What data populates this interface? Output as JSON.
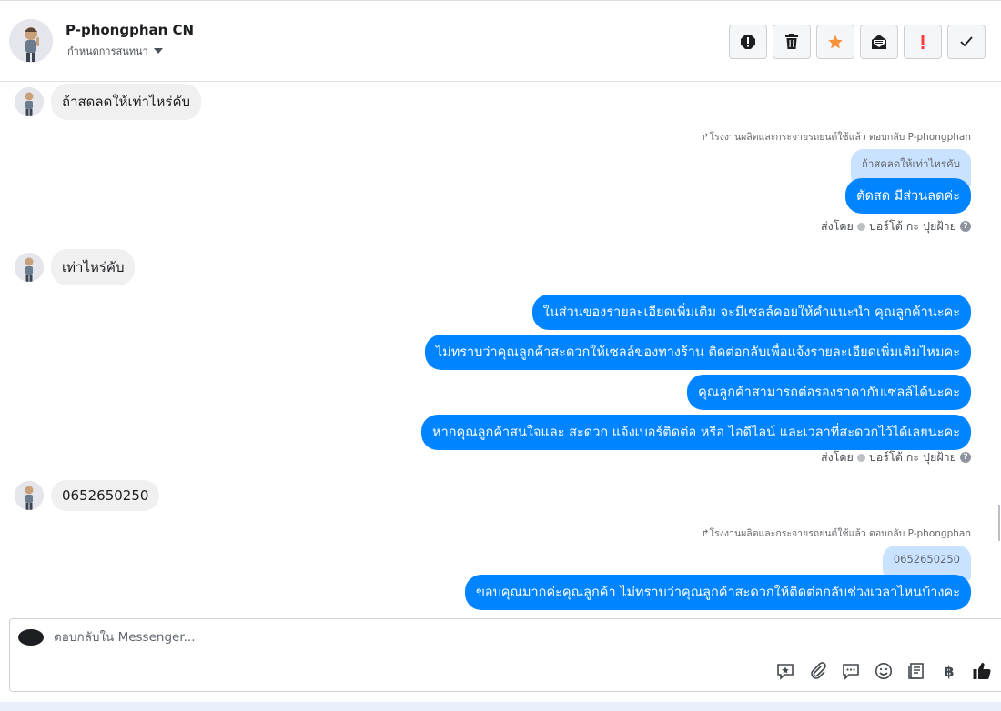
{
  "header": {
    "name": "P-phongphan CN",
    "sub_label": "กำหนดการสนทนา"
  },
  "messages": {
    "in_1": "ถ้าสดลดให้เท่าไหร่คับ",
    "reply_note_1": "โรงงานผลิตและกระจายรถยนต์ใช้แล้ว ตอบกลับ P-phongphan",
    "quoted_1": "ถ้าสดลดให้เท่าไหร่คับ",
    "out_1": "ตัดสด มีส่วนลดค่ะ",
    "sent_by_1": "ส่งโดย",
    "sender_1": "ปอร์โต้ กะ ปุยฝ้าย",
    "in_2": "เท่าไหร่คับ",
    "out_2": [
      "ในส่วนของรายละเอียดเพิ่มเติม จะมีเซลล์คอยให้คำแนะนำ คุณลูกค้านะคะ",
      "ไม่ทราบว่าคุณลูกค้าสะดวกให้เซลล์ของทางร้าน ติดต่อกลับเพื่อแจ้งรายละเอียดเพิ่มเติมไหมคะ",
      "คุณลูกค้าสามารถต่อรองราคากับเซลล์ได้นะคะ",
      "หากคุณลูกค้าสนใจและ สะดวก แจ้งเบอร์ติดต่อ หรือ ไอดีไลน์ และเวลาที่สะดวกไว้ได้เลยนะคะ"
    ],
    "sent_by_2": "ส่งโดย",
    "sender_2": "ปอร์โต้ กะ ปุยฝ้าย",
    "in_3": "0652650250",
    "reply_note_2": "โรงงานผลิตและกระจายรถยนต์ใช้แล้ว ตอบกลับ P-phongphan",
    "quoted_2": "0652650250",
    "out_3": "ขอบคุณมากค่ะคุณลูกค้า ไม่ทราบว่าคุณลูกค้าสะดวกให้ติดต่อกลับช่วงเวลาไหนบ้างคะ"
  },
  "composer": {
    "placeholder": "ตอบกลับใน Messenger...",
    "baht_symbol": "฿"
  },
  "colors": {
    "accent": "#0084ff",
    "incoming_bubble": "#f0f0f0",
    "quoted_bubble": "#c9e2ff",
    "star": "#f7923b",
    "alert": "#fa3e3e"
  },
  "icons": [
    "report-icon",
    "trash-icon",
    "star-icon",
    "mail-icon",
    "exclamation-icon",
    "check-icon",
    "reply-arrow-icon",
    "saved-reply-icon",
    "attachment-icon",
    "chat-bubble-icon",
    "emoji-icon",
    "notes-icon",
    "baht-icon",
    "like-icon"
  ]
}
